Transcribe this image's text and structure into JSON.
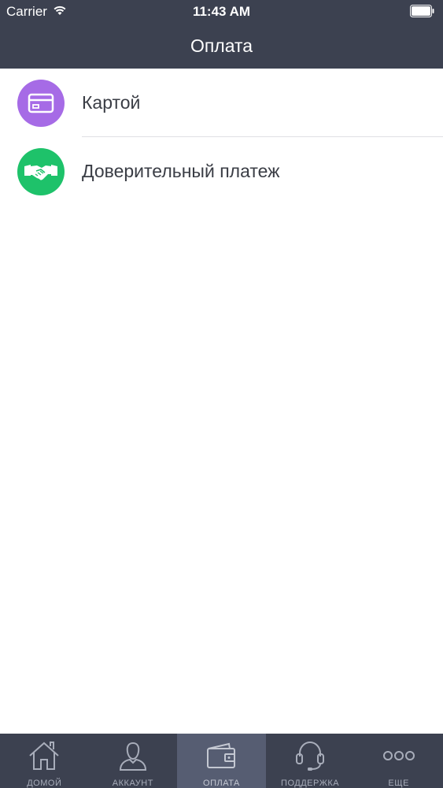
{
  "status_bar": {
    "carrier": "Carrier",
    "time": "11:43 AM"
  },
  "nav": {
    "title": "Оплата"
  },
  "payment_methods": [
    {
      "label": "Картой",
      "icon": "credit-card-icon",
      "color": "#a66be6"
    },
    {
      "label": "Доверительный платеж",
      "icon": "handshake-icon",
      "color": "#1ec26a"
    }
  ],
  "tab_bar": {
    "tabs": [
      {
        "label": "ДОМОЙ",
        "icon": "home-icon",
        "active": false
      },
      {
        "label": "АККАУНТ",
        "icon": "user-icon",
        "active": false
      },
      {
        "label": "ОПЛАТА",
        "icon": "wallet-icon",
        "active": true
      },
      {
        "label": "ПОДДЕРЖКА",
        "icon": "headset-icon",
        "active": false
      },
      {
        "label": "ЕЩЕ",
        "icon": "more-icon",
        "active": false
      }
    ]
  },
  "colors": {
    "header_bg": "#3c4150",
    "tab_active_bg": "#565d72",
    "text": "#3a3d45"
  }
}
